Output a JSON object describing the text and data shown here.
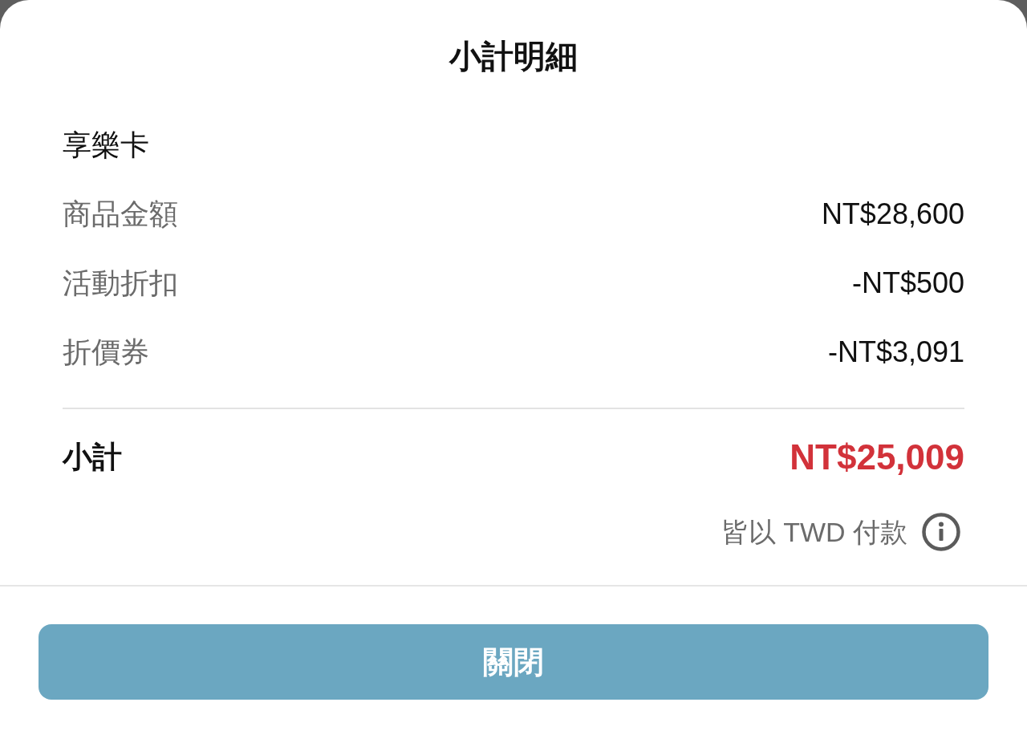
{
  "sheet": {
    "title": "小計明細"
  },
  "section": {
    "title": "享樂卡"
  },
  "lines": [
    {
      "label": "商品金額",
      "value": "NT$28,600"
    },
    {
      "label": "活動折扣",
      "value": "-NT$500"
    },
    {
      "label": "折價券",
      "value": "-NT$3,091"
    }
  ],
  "subtotal": {
    "label": "小計",
    "value": "NT$25,009"
  },
  "note": {
    "text": "皆以 TWD 付款"
  },
  "buttons": [
    {
      "label": "關閉"
    }
  ]
}
